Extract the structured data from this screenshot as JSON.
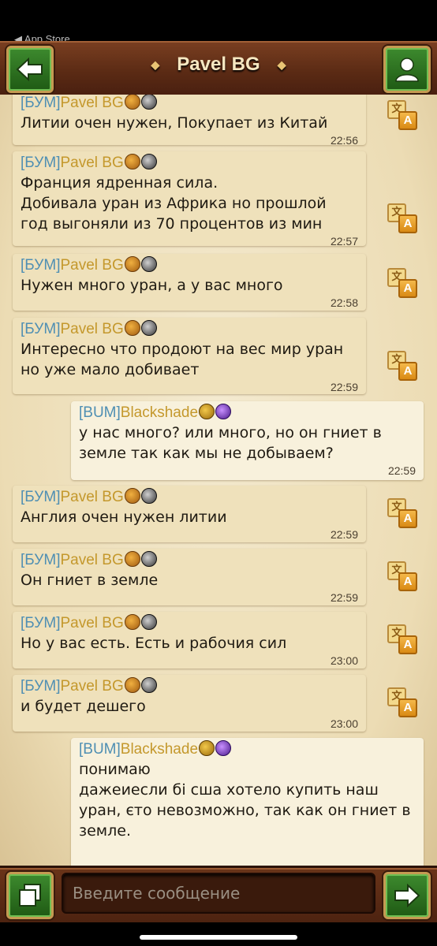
{
  "status_bar": {
    "back_app": "◀ App Store"
  },
  "header": {
    "title": "Pavel BG"
  },
  "messages": [
    {
      "clan": "[БУМ]",
      "sender": "Pavel BG",
      "text": "Литии очен нужен, Покупает из Китай",
      "time": "22:56"
    },
    {
      "clan": "[БУМ]",
      "sender": "Pavel BG",
      "text": "Франция ядренная сила.\nДобивала уран из Африка но прошлой год выгоняли из 70 процентов из мин",
      "time": "22:57"
    },
    {
      "clan": "[БУМ]",
      "sender": "Pavel BG",
      "text": "Нужен много уран, а у вас много",
      "time": "22:58"
    },
    {
      "clan": "[БУМ]",
      "sender": "Pavel BG",
      "text": "Интересно что продоют на вес мир уран но уже мало добивает",
      "time": "22:59"
    },
    {
      "clan": "[BUM]",
      "sender": "Blackshade",
      "text": "у нас много? или много, но он гниет в земле так как мы не добываем?",
      "time": "22:59"
    },
    {
      "clan": "[БУМ]",
      "sender": "Pavel BG",
      "text": "Англия очен нужен литии",
      "time": "22:59"
    },
    {
      "clan": "[БУМ]",
      "sender": "Pavel BG",
      "text": "Он гниет в земле",
      "time": "22:59"
    },
    {
      "clan": "[БУМ]",
      "sender": "Pavel BG",
      "text": "Но у вас есть. Есть и рабочия сил",
      "time": "23:00"
    },
    {
      "clan": "[БУМ]",
      "sender": "Pavel BG",
      "text": "и будет дешего",
      "time": "23:00"
    },
    {
      "clan": "[BUM]",
      "sender": "Blackshade",
      "text": "понимаю\nдажеиесли бі сша хотело купить наш уран, єто невозможно, так как он гниет в земле.",
      "time": ""
    }
  ],
  "input": {
    "placeholder": "Введите сообщение"
  },
  "icons": {
    "back": "arrow-left-icon",
    "profile": "person-icon",
    "translate": "translate-icon",
    "copy": "copy-icon",
    "send": "send-arrow-icon"
  },
  "colors": {
    "clan": "#4f8fb3",
    "name": "#c4982c",
    "button_green": "#2f7a22"
  }
}
